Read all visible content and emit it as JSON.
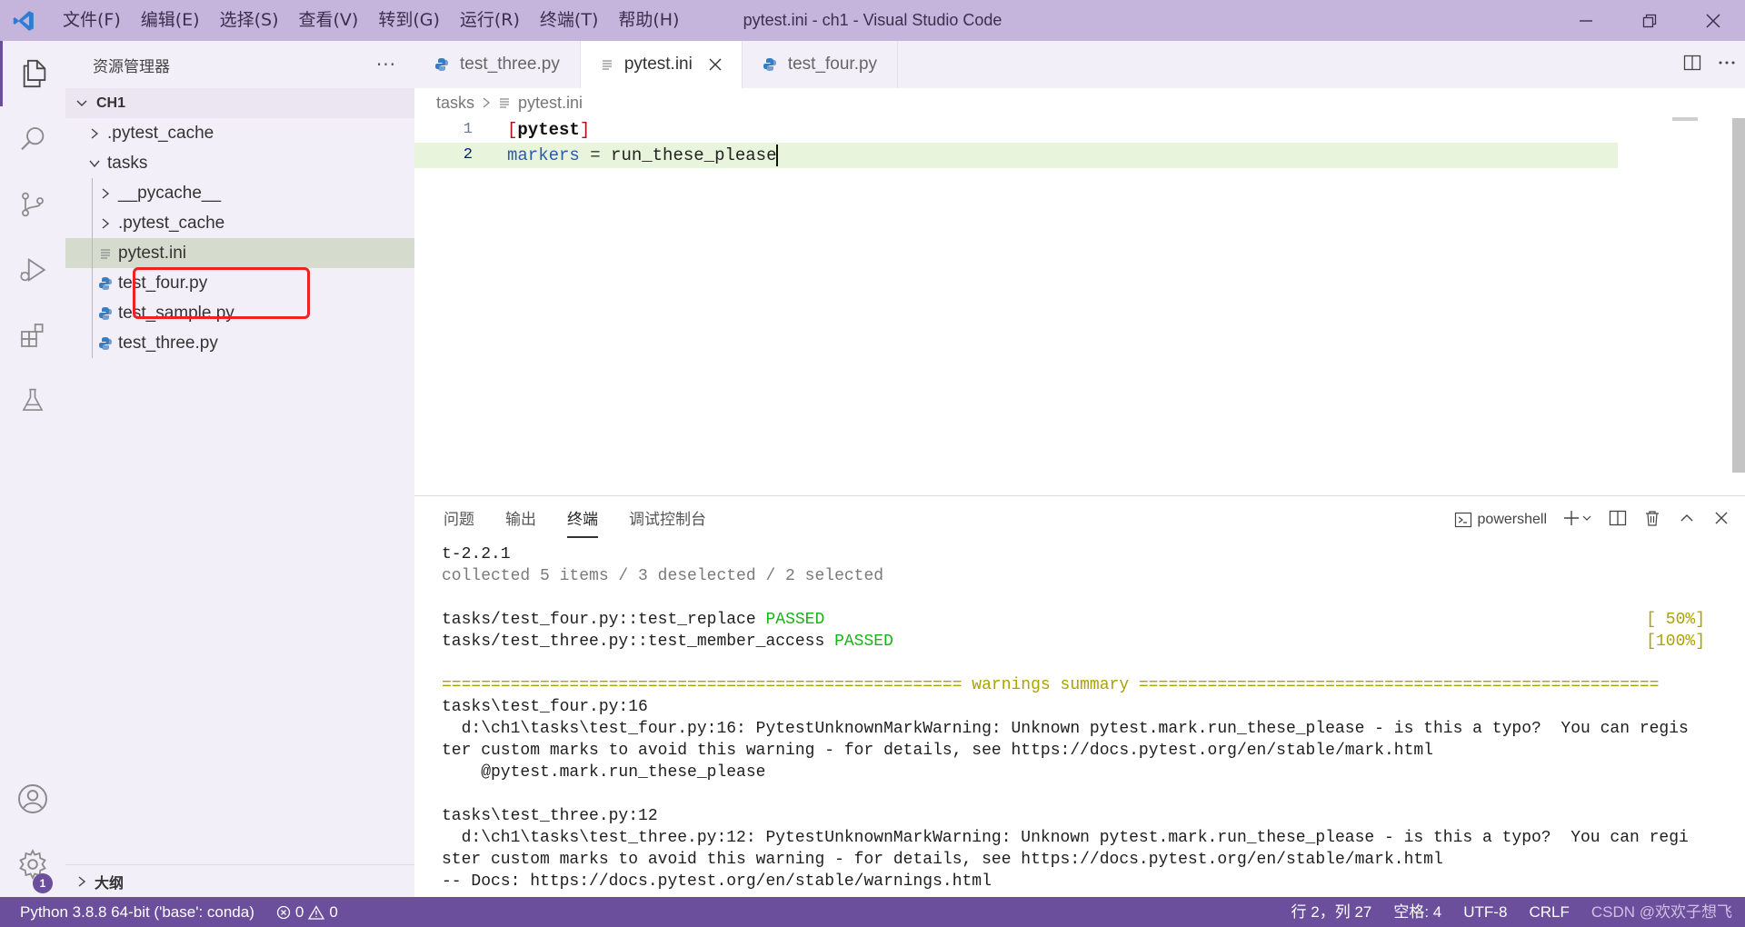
{
  "window": {
    "title": "pytest.ini - ch1 - Visual Studio Code",
    "menu": [
      "文件(F)",
      "编辑(E)",
      "选择(S)",
      "查看(V)",
      "转到(G)",
      "运行(R)",
      "终端(T)",
      "帮助(H)"
    ]
  },
  "activity_bar": {
    "items": [
      "files-icon",
      "search-icon",
      "source-control-icon",
      "run-debug-icon",
      "extensions-icon",
      "testing-icon"
    ],
    "bottom": [
      "account-icon",
      "settings-gear-icon"
    ],
    "settings_badge": "1"
  },
  "sidebar": {
    "title": "资源管理器",
    "more": "···",
    "root": "CH1",
    "tree": [
      {
        "label": ".pytest_cache",
        "type": "folder",
        "depth": 0,
        "expanded": false
      },
      {
        "label": "tasks",
        "type": "folder",
        "depth": 0,
        "expanded": true
      },
      {
        "label": "__pycache__",
        "type": "folder",
        "depth": 1,
        "expanded": false
      },
      {
        "label": ".pytest_cache",
        "type": "folder",
        "depth": 1,
        "expanded": false
      },
      {
        "label": "pytest.ini",
        "type": "ini",
        "depth": 1,
        "selected": true
      },
      {
        "label": "test_four.py",
        "type": "py",
        "depth": 1
      },
      {
        "label": "test_sample.py",
        "type": "py",
        "depth": 1
      },
      {
        "label": "test_three.py",
        "type": "py",
        "depth": 1
      }
    ],
    "outline": "大纲"
  },
  "editor": {
    "tabs": [
      {
        "label": "test_three.py",
        "type": "py",
        "active": false
      },
      {
        "label": "pytest.ini",
        "type": "ini",
        "active": true
      },
      {
        "label": "test_four.py",
        "type": "py",
        "active": false
      }
    ],
    "breadcrumb": [
      "tasks",
      "pytest.ini"
    ],
    "lines": [
      {
        "num": "1",
        "open": "[",
        "section": "pytest",
        "close": "]"
      },
      {
        "num": "2",
        "key": "markers",
        "op": " = ",
        "value": "run_these_please"
      }
    ]
  },
  "panel": {
    "tabs": [
      "问题",
      "输出",
      "终端",
      "调试控制台"
    ],
    "active_tab": "终端",
    "terminal_name": "powershell",
    "terminal": {
      "line1": "t-2.2.1",
      "line2": "collected 5 items / 3 deselected / 2 selected",
      "pass1_text": "tasks/test_four.py::test_replace ",
      "pass1_status": "PASSED",
      "pass1_pct": "[ 50%]",
      "pass2_text": "tasks/test_three.py::test_member_access ",
      "pass2_status": "PASSED",
      "pass2_pct": "[100%]",
      "summary": "===================================================== warnings summary =====================================================",
      "w1_file": "tasks\\test_four.py:16",
      "w1_msg_a": "  d:\\ch1\\tasks\\test_four.py:16: PytestUnknownMarkWarning: Unknown pytest.mark.run_these_please - is this a typo?  You can regis",
      "w1_msg_b": "ter custom marks to avoid this warning - for details, see https://docs.pytest.org/en/stable/mark.html",
      "w1_code": "    @pytest.mark.run_these_please",
      "w2_file": "tasks\\test_three.py:12",
      "w2_msg_a": "  d:\\ch1\\tasks\\test_three.py:12: PytestUnknownMarkWarning: Unknown pytest.mark.run_these_please - is this a typo?  You can regi",
      "w2_msg_b": "ster custom marks to avoid this warning - for details, see https://docs.pytest.org/en/stable/mark.html",
      "docs": "-- Docs: https://docs.pytest.org/en/stable/warnings.html"
    }
  },
  "statusbar": {
    "python": "Python 3.8.8 64-bit ('base': conda)",
    "errors": "0",
    "warnings": "0",
    "position": "行 2，列 27",
    "spaces": "空格: 4",
    "encoding": "UTF-8",
    "eol": "CRLF",
    "watermark": "CSDN @欢欢子想飞"
  },
  "colors": {
    "titlebar": "#c5b4dc",
    "statusbar": "#6b4e9c",
    "pass": "#16b316",
    "warn": "#a8a300",
    "highlight_box": "#ee2222"
  }
}
